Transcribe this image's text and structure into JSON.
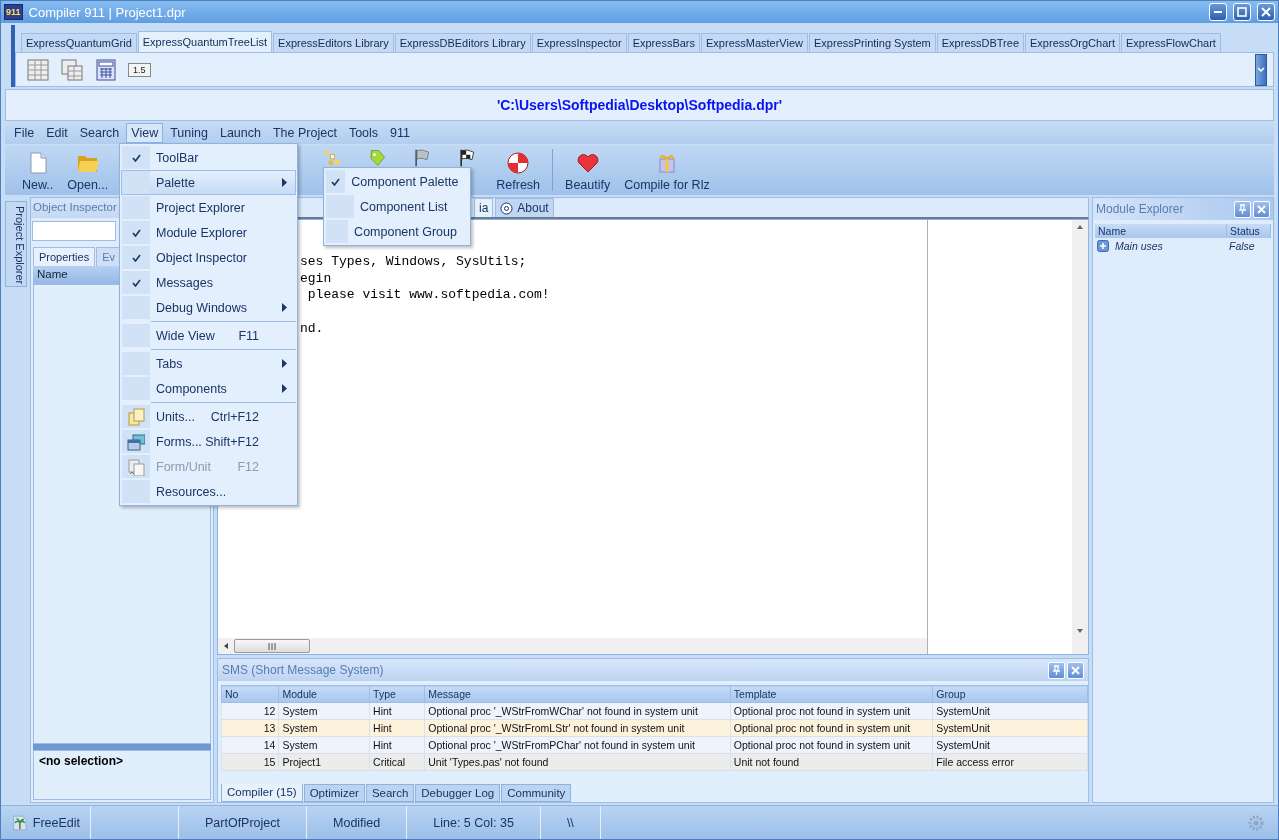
{
  "window": {
    "logo": "911",
    "title": "Compiler 911 | Project1.dpr"
  },
  "palette": {
    "tabs": [
      {
        "label": "ExpressQuantumGrid",
        "selected": false
      },
      {
        "label": "ExpressQuantumTreeList",
        "selected": true
      },
      {
        "label": "ExpressEditors Library",
        "selected": false
      },
      {
        "label": "ExpressDBEditors Library",
        "selected": false
      },
      {
        "label": "ExpressInspector",
        "selected": false
      },
      {
        "label": "ExpressBars",
        "selected": false
      },
      {
        "label": "ExpressMasterView",
        "selected": false
      },
      {
        "label": "ExpressPrinting System",
        "selected": false
      },
      {
        "label": "ExpressDBTree",
        "selected": false
      },
      {
        "label": "ExpressOrgChart",
        "selected": false
      },
      {
        "label": "ExpressFlowChart",
        "selected": false
      }
    ],
    "components": [
      {
        "kind": "grid"
      },
      {
        "kind": "multigrid"
      },
      {
        "kind": "calculator"
      },
      {
        "kind": "spin",
        "text": "1.5"
      }
    ]
  },
  "path": "'C:\\Users\\Softpedia\\Desktop\\Softpedia.dpr'",
  "menubar": [
    {
      "label": "File",
      "selected": false
    },
    {
      "label": "Edit",
      "selected": false
    },
    {
      "label": "Search",
      "selected": false
    },
    {
      "label": "View",
      "selected": true
    },
    {
      "label": "Tuning",
      "selected": false
    },
    {
      "label": "Launch",
      "selected": false
    },
    {
      "label": "The Project",
      "selected": false
    },
    {
      "label": "Tools",
      "selected": false
    },
    {
      "label": "911",
      "selected": false
    }
  ],
  "toolbar": [
    {
      "kind": "document",
      "label": "New.."
    },
    {
      "kind": "folder",
      "label": "Open..."
    },
    {
      "kind": "blocks"
    },
    {
      "kind": "tag"
    },
    {
      "kind": "flag"
    },
    {
      "kind": "checkered"
    },
    {
      "kind": "lifebuoy",
      "label": "Refresh"
    },
    {
      "kind": "separator"
    },
    {
      "kind": "heart",
      "label": "Beautify"
    },
    {
      "kind": "gift",
      "label": "Compile for Rlz"
    }
  ],
  "side_tab": "Project Explorer",
  "object_inspector": {
    "title": "Object Inspector",
    "tabs": [
      {
        "label": "Properties",
        "selected": true
      },
      {
        "label": "Ev",
        "selected": false
      }
    ],
    "columns": [
      "Name"
    ],
    "footer": "<no selection>"
  },
  "editor": {
    "tabs": [
      {
        "label": "ia",
        "selected": true
      },
      {
        "label": "About",
        "selected": false
      }
    ],
    "lines": [
      "ses Types, Windows, SysUtils;",
      "egin",
      " please visit www.softpedia.com!",
      "nd."
    ]
  },
  "module_explorer": {
    "title": "Module Explorer",
    "columns": [
      "Name",
      "Status"
    ],
    "rows": [
      {
        "name": "Main uses",
        "status": "False",
        "expanded": false
      }
    ]
  },
  "sms": {
    "title": "SMS (Short Message System)",
    "columns": [
      "No",
      "Module",
      "Type",
      "Message",
      "Template",
      "Group"
    ],
    "rows": [
      {
        "kind": "hint",
        "cells": [
          "12",
          "System",
          "Hint",
          "Optional proc '_WStrFromWChar' not found in system unit",
          "Optional proc not found in system unit",
          "SystemUnit"
        ]
      },
      {
        "kind": "hint",
        "cells": [
          "13",
          "System",
          "Hint",
          "Optional proc '_WStrFromLStr' not found in system unit",
          "Optional proc not found in system unit",
          "SystemUnit"
        ]
      },
      {
        "kind": "hint",
        "cells": [
          "14",
          "System",
          "Hint",
          "Optional proc '_WStrFromPChar' not found in system unit",
          "Optional proc not found in system unit",
          "SystemUnit"
        ]
      },
      {
        "kind": "critical",
        "cells": [
          "15",
          "Project1",
          "Critical",
          "Unit 'Types.pas' not found",
          "Unit not found",
          "File access error"
        ]
      }
    ],
    "tabs": [
      {
        "label": "Compiler (15)",
        "selected": true
      },
      {
        "label": "Optimizer",
        "selected": false
      },
      {
        "label": "Search",
        "selected": false
      },
      {
        "label": "Debugger Log",
        "selected": false
      },
      {
        "label": "Community",
        "selected": false
      }
    ]
  },
  "status_bar": [
    {
      "kind": "app",
      "text": "FreeEdit"
    },
    {
      "kind": "blank"
    },
    {
      "kind": "text",
      "text": "PartOfProject"
    },
    {
      "kind": "text",
      "text": "Modified"
    },
    {
      "kind": "text",
      "text": "Line: 5 Col: 35"
    },
    {
      "kind": "text",
      "text": "\\\\"
    }
  ],
  "view_menu": {
    "items": [
      {
        "kind": "item",
        "label": "ToolBar",
        "checked": true,
        "selected": false,
        "disabled": false,
        "submenu": false
      },
      {
        "kind": "item",
        "label": "Palette",
        "checked": false,
        "selected": true,
        "disabled": false,
        "submenu": true
      },
      {
        "kind": "item",
        "label": "Project Explorer",
        "checked": false,
        "selected": false,
        "disabled": false,
        "submenu": false
      },
      {
        "kind": "item",
        "label": "Module Explorer",
        "checked": true,
        "selected": false,
        "disabled": false,
        "submenu": false
      },
      {
        "kind": "item",
        "label": "Object Inspector",
        "checked": true,
        "selected": false,
        "disabled": false,
        "submenu": false
      },
      {
        "kind": "item",
        "label": "Messages",
        "checked": true,
        "selected": false,
        "disabled": false,
        "submenu": false
      },
      {
        "kind": "item",
        "label": "Debug Windows",
        "checked": false,
        "selected": false,
        "disabled": false,
        "submenu": true
      },
      {
        "kind": "separator"
      },
      {
        "kind": "item",
        "label": "Wide View",
        "shortcut": "F11",
        "checked": false,
        "selected": false,
        "disabled": false,
        "submenu": false
      },
      {
        "kind": "separator"
      },
      {
        "kind": "item",
        "label": "Tabs",
        "checked": false,
        "selected": false,
        "disabled": false,
        "submenu": true
      },
      {
        "kind": "item",
        "label": "Components",
        "checked": false,
        "selected": false,
        "disabled": false,
        "submenu": true
      },
      {
        "kind": "separator"
      },
      {
        "kind": "item",
        "label": "Units...",
        "shortcut": "Ctrl+F12",
        "checked": false,
        "selected": false,
        "disabled": false,
        "submenu": false
      },
      {
        "kind": "item",
        "label": "Forms...",
        "shortcut": "Shift+F12",
        "checked": false,
        "selected": false,
        "disabled": false,
        "submenu": false
      },
      {
        "kind": "item",
        "label": "Form/Unit",
        "shortcut": "F12",
        "checked": false,
        "selected": false,
        "disabled": true,
        "submenu": false
      },
      {
        "kind": "item",
        "label": "Resources...",
        "checked": false,
        "selected": false,
        "disabled": false,
        "submenu": false
      }
    ]
  },
  "palette_menu": {
    "items": [
      {
        "kind": "item",
        "label": "Component Palette",
        "checked": true,
        "selected": false,
        "disabled": false,
        "submenu": false
      },
      {
        "kind": "item",
        "label": "Component List",
        "checked": false,
        "selected": false,
        "disabled": false,
        "submenu": false
      },
      {
        "kind": "item",
        "label": "Component Group",
        "checked": false,
        "selected": false,
        "disabled": false,
        "submenu": false
      }
    ]
  }
}
